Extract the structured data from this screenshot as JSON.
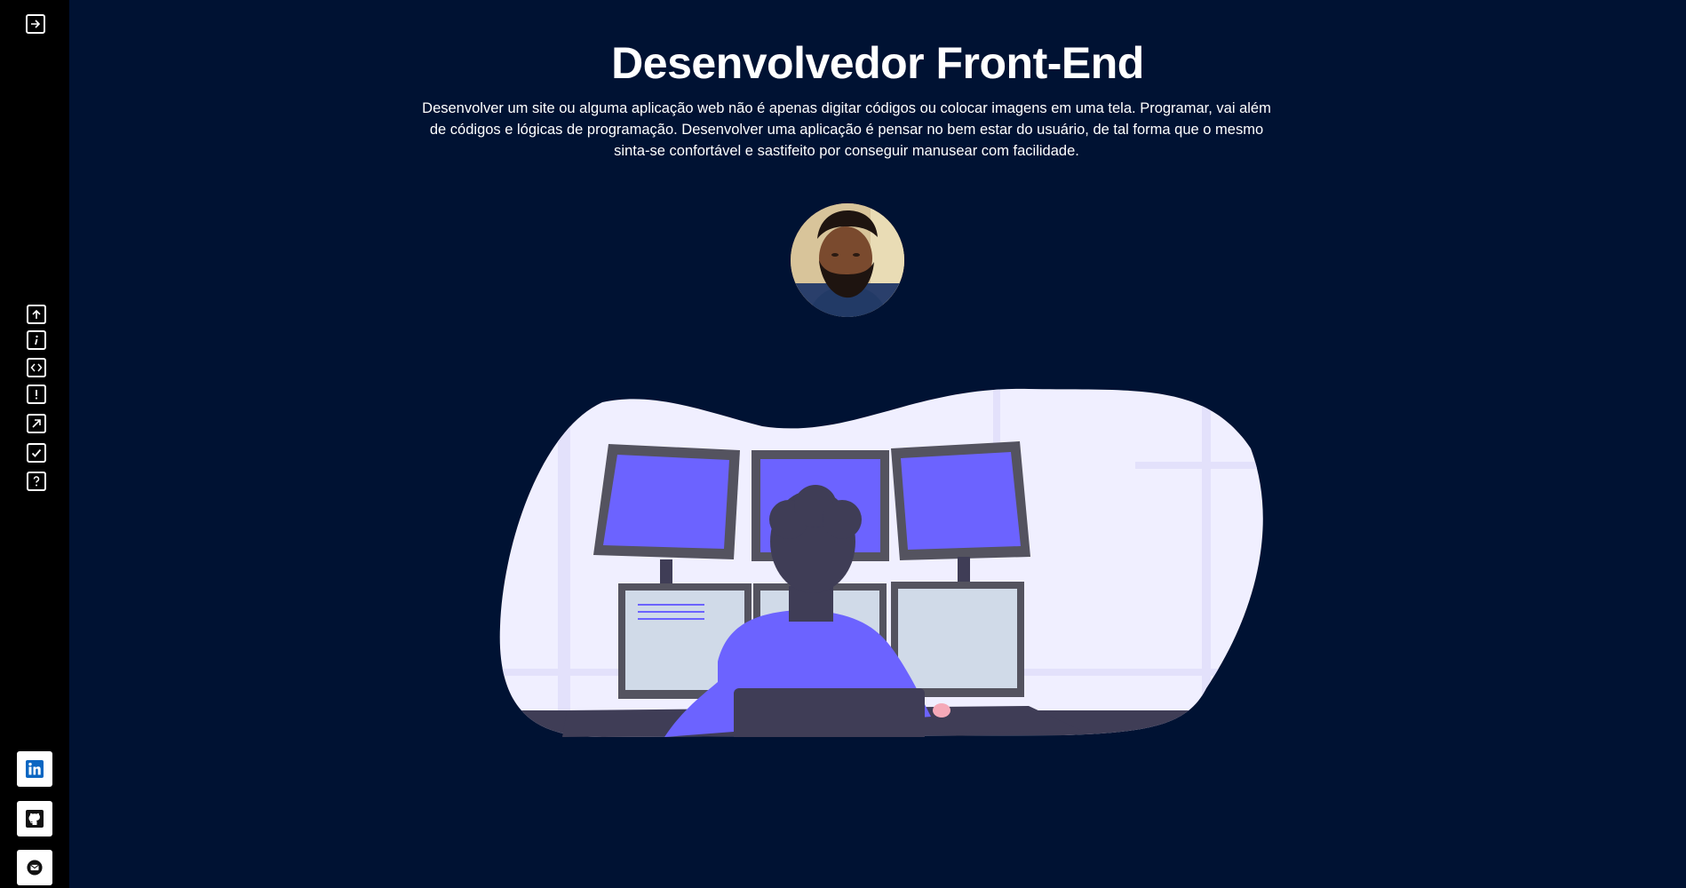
{
  "sidebar": {
    "toggle_icon": "arrow-right-box-icon",
    "nav": [
      {
        "icon": "arrow-up-box-icon",
        "name": "nav-top"
      },
      {
        "icon": "info-icon",
        "name": "nav-about"
      },
      {
        "icon": "code-icon",
        "name": "nav-skills"
      },
      {
        "icon": "exclamation-icon",
        "name": "nav-highlights"
      },
      {
        "icon": "arrow-up-right-icon",
        "name": "nav-projects"
      },
      {
        "icon": "checkbox-icon",
        "name": "nav-services"
      },
      {
        "icon": "question-icon",
        "name": "nav-faq"
      }
    ],
    "social": [
      {
        "icon": "linkedin-icon"
      },
      {
        "icon": "github-icon"
      },
      {
        "icon": "email-icon"
      }
    ]
  },
  "hero": {
    "title": "Desenvolvedor Front-End",
    "description": "Desenvolver um site ou alguma aplicação web não é apenas digitar códigos ou colocar imagens em uma tela. Programar, vai além de códigos e lógicas de programação. Desenvolver uma aplicação é pensar no bem estar do usuário, de tal forma que o mesmo sinta-se confortável e sastifeito por conseguir manusear com facilidade."
  },
  "colors": {
    "background": "#001233",
    "sidebar": "#000000",
    "accent": "#6c63ff",
    "blob": "#f0efff"
  }
}
